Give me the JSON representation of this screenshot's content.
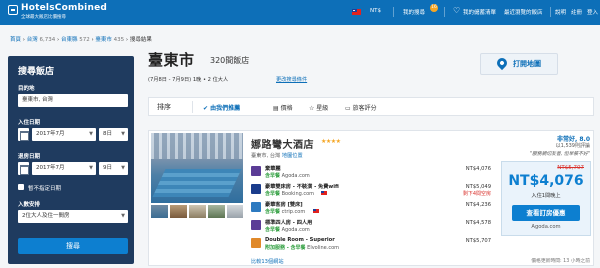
{
  "header": {
    "logo_text": "HotelsCombined",
    "logo_tagline": "全球最大飯店比價搜尋",
    "currency": "NT$",
    "my_search_label": "我的搜尋",
    "my_search_badge": "16",
    "saved_label": "我的儲蓄清單",
    "recent_label": "最近瀏覽的飯店",
    "support_label": "說明",
    "register_label": "註冊",
    "login_label": "登入"
  },
  "breadcrumb": {
    "home": "首頁",
    "country": "台灣",
    "country_count": "6,734",
    "region": "台東縣",
    "region_count": "572",
    "city": "臺東市",
    "city_count": "435",
    "current": "搜尋結果",
    "sep": "›"
  },
  "search": {
    "title": "搜尋飯店",
    "destination_label": "目的地",
    "destination_value": "臺東市, 台灣",
    "checkin_label": "入住日期",
    "checkin_month": "2017年7月",
    "checkin_day": "8日",
    "checkout_label": "退房日期",
    "checkout_month": "2017年7月",
    "checkout_day": "9日",
    "no_dates_label": "暫不指定日期",
    "guests_label": "入數安排",
    "guests_value": "2位大人及住一間房",
    "search_button": "搜尋"
  },
  "results": {
    "city": "臺東市",
    "count": "320間飯店",
    "dates": "(7月8日 - 7月9日) 1晚 • 2 位大人",
    "modify_link": "更改搜尋條件",
    "map_button": "打開地圖",
    "sort_label": "排序",
    "sort_options": [
      {
        "label": "由我們推薦",
        "icon": "check-icon"
      },
      {
        "label": "價格",
        "icon": "price-icon"
      },
      {
        "label": "星級",
        "icon": "star-icon"
      },
      {
        "label": "旅客評分",
        "icon": "chat-icon"
      }
    ]
  },
  "hotel": {
    "name": "娜路彎大酒店",
    "stars": "★★★★",
    "location": "臺東市, 台灣",
    "map_link": "地圖位置",
    "rating": "非常好, 8.0",
    "reviews": "以1,539則評論",
    "review_quote": "\"服務親切友善, 但早餐不好\"",
    "offers": [
      {
        "provider": "棄華麗",
        "sub_prefix": "含早餐",
        "sub": "Agoda.com",
        "price": "NT$4,076",
        "note": "",
        "logo_color": "#5b3c96"
      },
      {
        "provider": "豪華雙床房 - 不裝潢 - 免費wifi",
        "sub_prefix": "含早餐",
        "sub": "Booking.com",
        "price": "NT$5,049",
        "note": "剩下4間空房",
        "logo_color": "#1a3c8c"
      },
      {
        "provider": "豪華客房 [雙床]",
        "sub_prefix": "含早餐",
        "sub": "ctrip.com",
        "price": "NT$4,236",
        "note": "",
        "logo_color": "#2d7ac0"
      },
      {
        "provider": "標準四人房 - 四人用",
        "sub_prefix": "含早餐",
        "sub": "Agoda.com",
        "price": "NT$4,578",
        "note": "",
        "logo_color": "#5b3c96"
      },
      {
        "provider": "Double Room - Superior",
        "sub_prefix": "附加服務 - 含早餐",
        "sub": "Elvoline.com",
        "price": "NT$5,707",
        "note": "",
        "logo_color": "#e0892a"
      }
    ],
    "more_link": "比較13個網站",
    "old_price": "NT$5,707",
    "price": "NT$4,076",
    "per_night": "入住1間晚上",
    "book_button": "查看訂房優惠",
    "book_source": "Agoda.com",
    "updated": "價格更新時間: 13 小時之前"
  },
  "colors": {
    "brand": "#0d6fb8",
    "sidebar": "#1f3b5f",
    "accent": "#0d7fd0",
    "discount": "#d9302b",
    "included": "#2e9e3e"
  }
}
